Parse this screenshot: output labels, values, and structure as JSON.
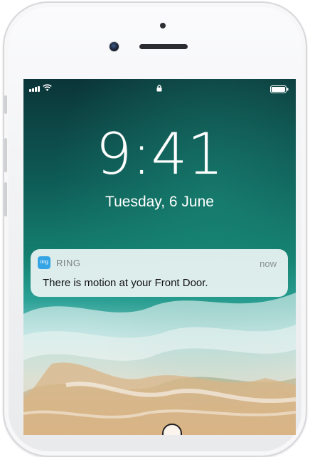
{
  "lockscreen": {
    "time": "9:41",
    "date": "Tuesday, 6 June"
  },
  "notification": {
    "app_icon_text": "ring",
    "app_name": "RING",
    "time": "now",
    "message": "There is motion at your Front Door."
  },
  "icons": {
    "status_left": [
      "signal-bars-icon",
      "wifi-icon"
    ],
    "status_center": "lock-icon",
    "status_right": "battery-icon",
    "bottom": "camera-icon"
  },
  "colors": {
    "notification_bg": "#ecf4f4",
    "ring_blue": "#35a4e5",
    "phone_body": "#f3f4f6"
  }
}
